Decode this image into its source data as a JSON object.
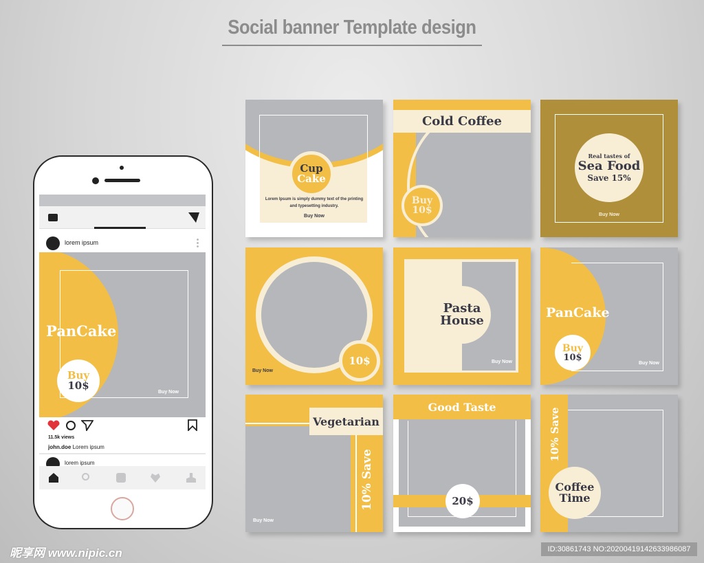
{
  "title": "Social banner Template design",
  "colors": {
    "yellow": "#f2be45",
    "gray": "#b5b7bb",
    "cream": "#f8eed6",
    "gold": "#b08f3a",
    "text": "#3a3a46",
    "like": "#e0353b"
  },
  "phone": {
    "icons": [
      "camera-icon",
      "send-filter-icon",
      "heart-icon",
      "comment-icon",
      "share-icon",
      "bookmark-icon",
      "home-icon",
      "search-icon",
      "square-icon",
      "heart-outline-icon",
      "profile-icon"
    ],
    "post_user": "lorem ipsum",
    "post": {
      "title": "PanCake",
      "buy": "Buy",
      "price": "10$",
      "cta": "Buy Now"
    },
    "views": "11.5k views",
    "caption_user": "john.doe",
    "caption": "Lorem ipsum",
    "next_user": "lorem ipsum"
  },
  "tiles": {
    "cupcake": {
      "line1": "Cup",
      "line2": "Cake",
      "body": "Lorem Ipsum is simply dummy text of the printing and typesetting industry.",
      "cta": "Buy Now"
    },
    "cold_coffee": {
      "title": "Cold Coffee",
      "buy": "Buy",
      "price": "10$"
    },
    "sea_food": {
      "pre": "Real tastes of",
      "title": "Sea Food",
      "save": "Save 15%",
      "cta": "Buy Now"
    },
    "circle": {
      "price": "10$",
      "cta": "Buy Now"
    },
    "pasta": {
      "line1": "Pasta",
      "line2": "House",
      "cta": "Buy Now"
    },
    "pancake": {
      "title": "PanCake",
      "buy": "Buy",
      "price": "10$",
      "cta": "Buy Now"
    },
    "vegetarian": {
      "title": "Vegetarian",
      "save": "10% Save",
      "cta": "Buy Now"
    },
    "good_taste": {
      "title": "Good Taste",
      "price": "20$"
    },
    "coffee_time": {
      "line1": "Coffee",
      "line2": "Time",
      "save": "10% Save"
    }
  },
  "watermark": {
    "logo": "昵享网 www.nipic.cn",
    "id": "ID:30861743 NO:20200419142633986087"
  }
}
